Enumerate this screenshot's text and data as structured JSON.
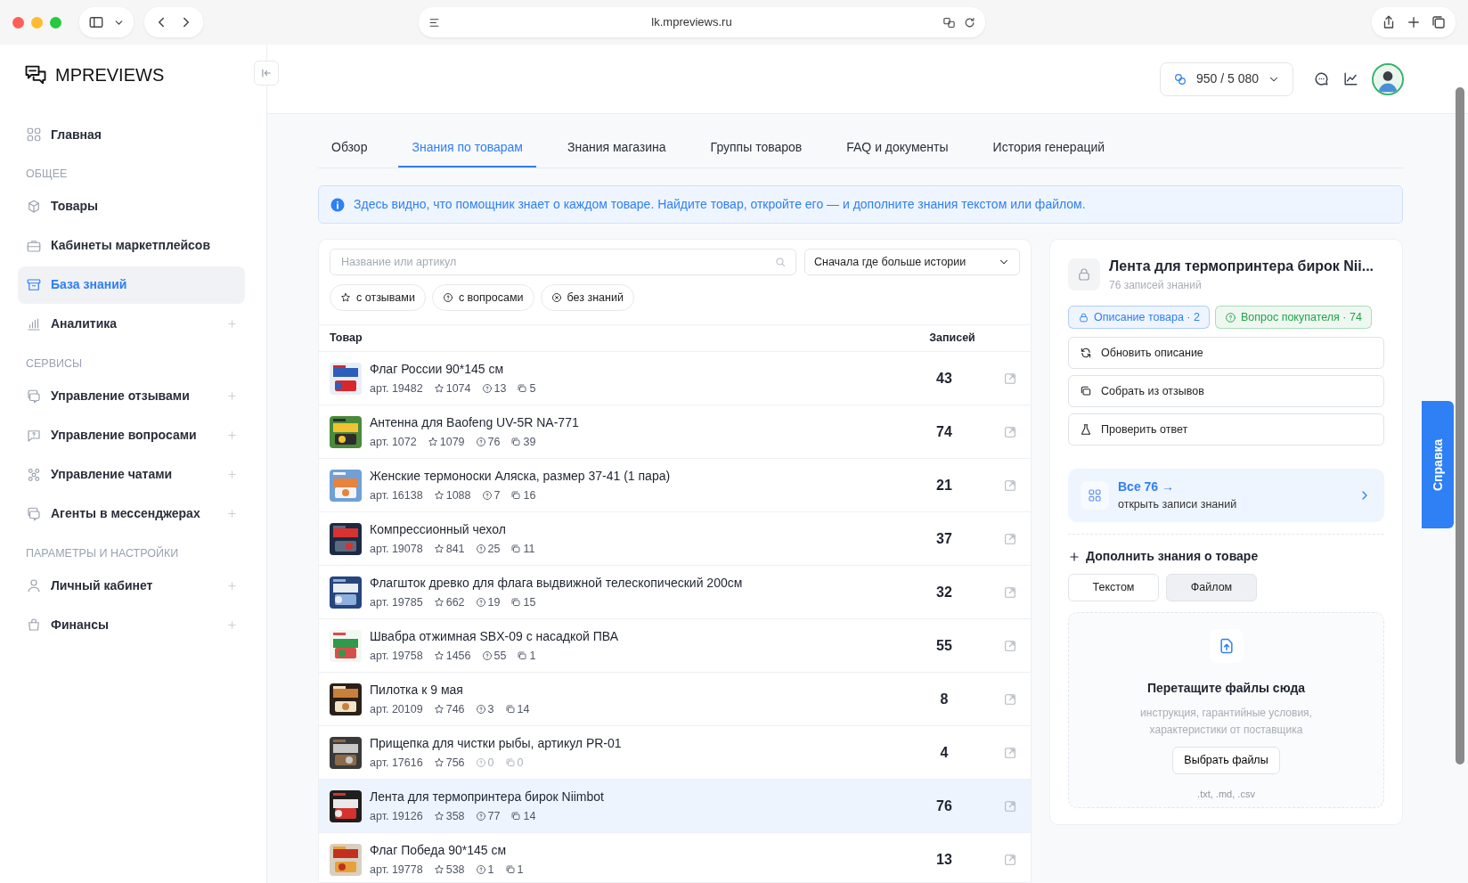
{
  "browser": {
    "url": "lk.mpreviews.ru"
  },
  "logo": {
    "text": "MPREVIEWS"
  },
  "sidebar": {
    "sections": [
      {
        "items": [
          {
            "label": "Главная",
            "selected": false,
            "expandable": false
          }
        ]
      },
      {
        "heading": "ОБЩЕЕ",
        "items": [
          {
            "label": "Товары",
            "selected": false,
            "expandable": false
          },
          {
            "label": "Кабинеты маркетплейсов",
            "selected": false,
            "expandable": false
          },
          {
            "label": "База знаний",
            "selected": true,
            "expandable": false
          },
          {
            "label": "Аналитика",
            "selected": false,
            "expandable": true
          }
        ]
      },
      {
        "heading": "СЕРВИСЫ",
        "items": [
          {
            "label": "Управление отзывами",
            "selected": false,
            "expandable": true
          },
          {
            "label": "Управление вопросами",
            "selected": false,
            "expandable": true
          },
          {
            "label": "Управление чатами",
            "selected": false,
            "expandable": true
          },
          {
            "label": "Агенты в мессенджерах",
            "selected": false,
            "expandable": true
          }
        ]
      },
      {
        "heading": "ПАРАМЕТРЫ И НАСТРОЙКИ",
        "items": [
          {
            "label": "Личный кабинет",
            "selected": false,
            "expandable": true
          },
          {
            "label": "Финансы",
            "selected": false,
            "expandable": true
          }
        ]
      }
    ]
  },
  "header": {
    "balance": "950 / 5 080"
  },
  "tabs": [
    {
      "label": "Обзор",
      "selected": false
    },
    {
      "label": "Знания по товарам",
      "selected": true
    },
    {
      "label": "Знания магазина",
      "selected": false
    },
    {
      "label": "Группы товаров",
      "selected": false
    },
    {
      "label": "FAQ и документы",
      "selected": false
    },
    {
      "label": "История генераций",
      "selected": false
    }
  ],
  "notice": "Здесь видно, что помощник знает о каждом товаре. Найдите товар, откройте его — и дополните знания текстом или файлом.",
  "search": {
    "placeholder": "Название или артикул"
  },
  "sort": {
    "value": "Сначала где больше истории"
  },
  "filters": [
    {
      "kind": "reviews",
      "label": "с отзывами"
    },
    {
      "kind": "questions",
      "label": "с вопросами"
    },
    {
      "kind": "empty",
      "label": "без знаний"
    }
  ],
  "table": {
    "columns": [
      "Товар",
      "Записей"
    ],
    "rows": [
      {
        "name": "Флаг России 90*145 см",
        "article": "арт. 19482",
        "stats": [
          {
            "kind": "rating",
            "value": "1074",
            "muted": false
          },
          {
            "kind": "questions",
            "value": "13",
            "muted": false
          },
          {
            "kind": "reviews",
            "value": "5",
            "muted": false
          }
        ],
        "records": "43",
        "selected": false
      },
      {
        "name": "Антенна для Baofeng UV-5R NA-771",
        "article": "арт. 1072",
        "stats": [
          {
            "kind": "rating",
            "value": "1079",
            "muted": false
          },
          {
            "kind": "questions",
            "value": "76",
            "muted": false
          },
          {
            "kind": "reviews",
            "value": "39",
            "muted": false
          }
        ],
        "records": "74",
        "selected": false
      },
      {
        "name": "Женские термоноски Аляска, размер 37-41 (1 пара)",
        "article": "арт. 16138",
        "stats": [
          {
            "kind": "rating",
            "value": "1088",
            "muted": false
          },
          {
            "kind": "questions",
            "value": "7",
            "muted": false
          },
          {
            "kind": "reviews",
            "value": "16",
            "muted": false
          }
        ],
        "records": "21",
        "selected": false
      },
      {
        "name": "Компрессионный чехол",
        "article": "арт. 19078",
        "stats": [
          {
            "kind": "rating",
            "value": "841",
            "muted": false
          },
          {
            "kind": "questions",
            "value": "25",
            "muted": false
          },
          {
            "kind": "reviews",
            "value": "11",
            "muted": false
          }
        ],
        "records": "37",
        "selected": false
      },
      {
        "name": "Флагшток древко для флага выдвижной телескопический 200см",
        "article": "арт. 19785",
        "stats": [
          {
            "kind": "rating",
            "value": "662",
            "muted": false
          },
          {
            "kind": "questions",
            "value": "19",
            "muted": false
          },
          {
            "kind": "reviews",
            "value": "15",
            "muted": false
          }
        ],
        "records": "32",
        "selected": false
      },
      {
        "name": "Швабра отжимная SBX-09 с насадкой ПВА",
        "article": "арт. 19758",
        "stats": [
          {
            "kind": "rating",
            "value": "1456",
            "muted": false
          },
          {
            "kind": "questions",
            "value": "55",
            "muted": false
          },
          {
            "kind": "reviews",
            "value": "1",
            "muted": false
          }
        ],
        "records": "55",
        "selected": false
      },
      {
        "name": "Пилотка к 9 мая",
        "article": "арт. 20109",
        "stats": [
          {
            "kind": "rating",
            "value": "746",
            "muted": false
          },
          {
            "kind": "questions",
            "value": "3",
            "muted": false
          },
          {
            "kind": "reviews",
            "value": "14",
            "muted": false
          }
        ],
        "records": "8",
        "selected": false
      },
      {
        "name": "Прищепка для чистки рыбы, артикул PR-01",
        "article": "арт. 17616",
        "stats": [
          {
            "kind": "rating",
            "value": "756",
            "muted": false
          },
          {
            "kind": "questions",
            "value": "0",
            "muted": true
          },
          {
            "kind": "reviews",
            "value": "0",
            "muted": true
          }
        ],
        "records": "4",
        "selected": false
      },
      {
        "name": "Лента для термопринтера бирок Niimbot",
        "article": "арт. 19126",
        "stats": [
          {
            "kind": "rating",
            "value": "358",
            "muted": false
          },
          {
            "kind": "questions",
            "value": "77",
            "muted": false
          },
          {
            "kind": "reviews",
            "value": "14",
            "muted": false
          }
        ],
        "records": "76",
        "selected": true
      },
      {
        "name": "Флаг Победа 90*145 см",
        "article": "арт. 19778",
        "stats": [
          {
            "kind": "rating",
            "value": "538",
            "muted": false
          },
          {
            "kind": "questions",
            "value": "1",
            "muted": false
          },
          {
            "kind": "reviews",
            "value": "1",
            "muted": false
          }
        ],
        "records": "13",
        "selected": false
      }
    ]
  },
  "detail": {
    "title": "Лента для термопринтера бирок Nii...",
    "subtitle": "76 записей знаний",
    "tags": [
      {
        "kind": "description",
        "label": "Описание товара · 2",
        "color": "#2f7ff5"
      },
      {
        "kind": "question",
        "label": "Вопрос покупателя · 74",
        "color": "#22a447"
      }
    ],
    "actions": [
      {
        "kind": "refresh",
        "label": "Обновить описание"
      },
      {
        "kind": "reviews",
        "label": "Собрать из отзывов"
      },
      {
        "kind": "check",
        "label": "Проверить ответ"
      }
    ],
    "all_link": {
      "title": "Все 76 →",
      "subtitle": "открыть записи знаний"
    },
    "add": {
      "heading": "Дополнить знания о товаре",
      "modes": [
        {
          "label": "Текстом",
          "selected": false
        },
        {
          "label": "Файлом",
          "selected": true
        }
      ],
      "dropzone": {
        "title": "Перетащите файлы сюда",
        "hint": "инструкция, гарантийные условия, характеристики от поставщика",
        "button": "Выбрать файлы",
        "formats": ".txt, .md, .csv"
      }
    }
  },
  "help_tab": "Справка"
}
